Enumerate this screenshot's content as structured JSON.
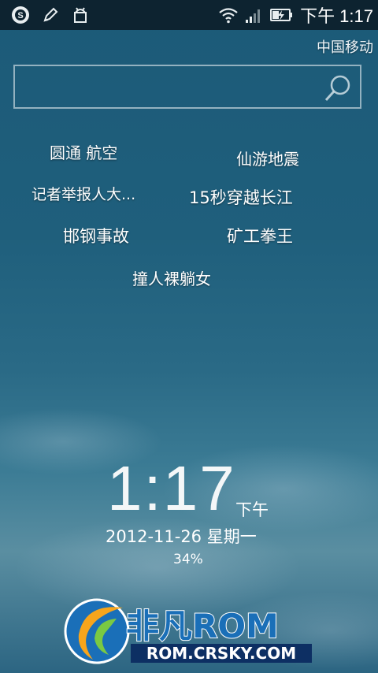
{
  "status_bar": {
    "left_icons": [
      "sogou-icon",
      "pencil-icon",
      "android-icon"
    ],
    "right_icons": [
      "wifi-icon",
      "signal-icon",
      "battery-charging-icon"
    ],
    "time": "下午 1:17"
  },
  "carrier": "中国移动",
  "search": {
    "placeholder": ""
  },
  "hot_words": [
    "圆通 航空",
    "仙游地震",
    "记者举报人大...",
    "15秒穿越长江",
    "邯钢事故",
    "矿工拳王",
    "撞人裸躺女"
  ],
  "lockscreen_clock": {
    "time": "1:17",
    "ampm": "下午",
    "date": "2012-11-26 星期一",
    "battery": "34%"
  },
  "watermark": {
    "logo_text": "非凡ROM",
    "url_text": "ROM.CRSKY.COM"
  },
  "colors": {
    "status_bar_bg": "#0d2330",
    "wallpaper_top": "#1c5a78",
    "watermark_green": "#7ac943"
  }
}
